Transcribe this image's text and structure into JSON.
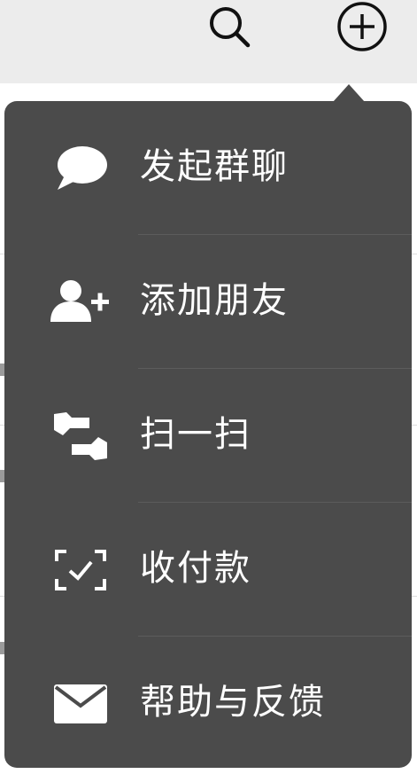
{
  "topbar": {
    "search_icon": "search-icon",
    "add_icon": "plus-circle-icon"
  },
  "menu": {
    "items": [
      {
        "label": "发起群聊",
        "icon": "chat-bubble-icon"
      },
      {
        "label": "添加朋友",
        "icon": "add-friend-icon"
      },
      {
        "label": "扫一扫",
        "icon": "scan-icon"
      },
      {
        "label": "收付款",
        "icon": "payment-scan-icon"
      },
      {
        "label": "帮助与反馈",
        "icon": "mail-icon"
      }
    ]
  },
  "colors": {
    "menu_background": "#4b4b4b",
    "menu_text": "#ffffff",
    "topbar_background": "#ececec"
  }
}
